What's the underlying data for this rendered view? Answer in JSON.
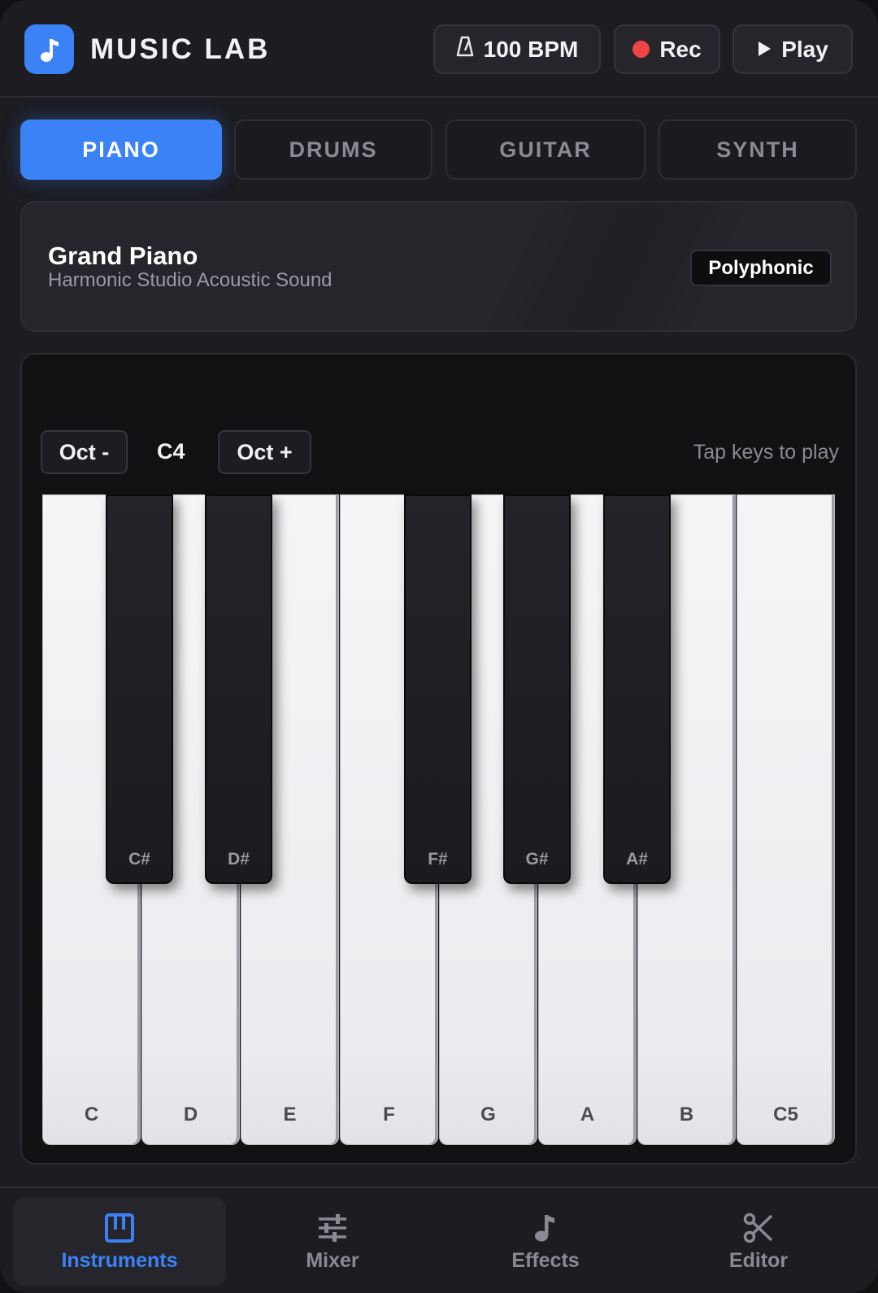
{
  "header": {
    "title": "MUSIC LAB",
    "bpm_label": "100 BPM",
    "rec_label": "Rec",
    "play_label": "Play"
  },
  "tabs": [
    {
      "label": "PIANO",
      "active": true
    },
    {
      "label": "DRUMS",
      "active": false
    },
    {
      "label": "GUITAR",
      "active": false
    },
    {
      "label": "SYNTH",
      "active": false
    }
  ],
  "instrument": {
    "name": "Grand Piano",
    "description": "Harmonic Studio Acoustic Sound",
    "badge": "Polyphonic"
  },
  "keyboard_controls": {
    "octave_down_label": "Oct -",
    "octave_value": "C4",
    "octave_up_label": "Oct +",
    "hint": "Tap keys to play"
  },
  "keys": {
    "white": [
      "C",
      "D",
      "E",
      "F",
      "G",
      "A",
      "B",
      "C5"
    ],
    "black": [
      "C#",
      "D#",
      "F#",
      "G#",
      "A#"
    ]
  },
  "bottom_nav": [
    {
      "label": "Instruments",
      "icon": "piano-icon",
      "active": true
    },
    {
      "label": "Mixer",
      "icon": "sliders-icon",
      "active": false
    },
    {
      "label": "Effects",
      "icon": "music-note-icon",
      "active": false
    },
    {
      "label": "Editor",
      "icon": "scissors-icon",
      "active": false
    }
  ],
  "colors": {
    "accent": "#3b82f6",
    "record": "#ef4444",
    "background": "#1c1c21",
    "panel": "#111114"
  }
}
